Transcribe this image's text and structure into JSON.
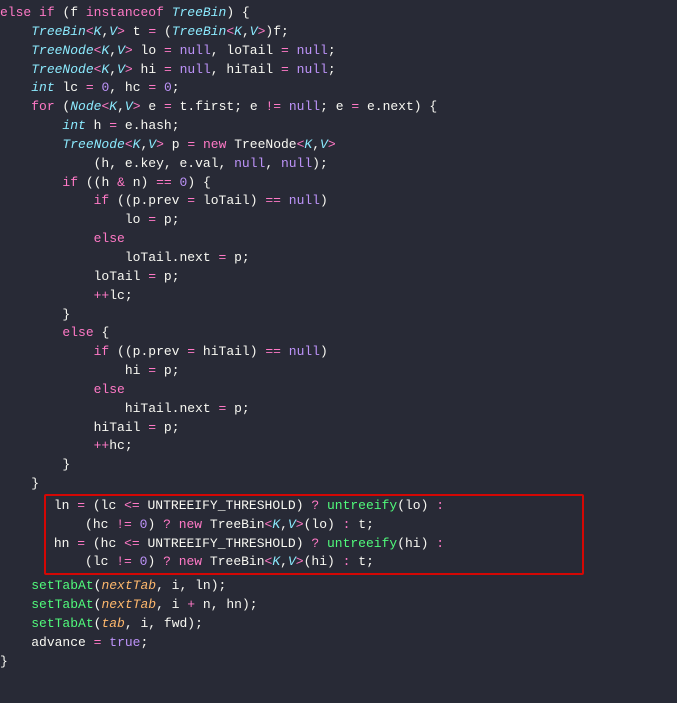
{
  "code": {
    "l01_else": "else",
    "l01_if": "if",
    "l01_f": "f",
    "l01_instanceof": "instanceof",
    "l01_TreeBin": "TreeBin",
    "l02_TreeBin": "TreeBin",
    "l02_K": "K",
    "l02_V": "V",
    "l02_t": "t",
    "l02_eq": "=",
    "l02_TreeBin2": "TreeBin",
    "l02_K2": "K",
    "l02_V2": "V",
    "l02_f": "f",
    "l03_TreeNode": "TreeNode",
    "l03_K": "K",
    "l03_V": "V",
    "l03_lo": "lo",
    "l03_eq1": "=",
    "l03_null1": "null",
    "l03_loTail": "loTail",
    "l03_eq2": "=",
    "l03_null2": "null",
    "l04_TreeNode": "TreeNode",
    "l04_K": "K",
    "l04_V": "V",
    "l04_hi": "hi",
    "l04_eq1": "=",
    "l04_null1": "null",
    "l04_hiTail": "hiTail",
    "l04_eq2": "=",
    "l04_null2": "null",
    "l05_int": "int",
    "l05_lc": "lc",
    "l05_eq1": "=",
    "l05_zero1": "0",
    "l05_hc": "hc",
    "l05_eq2": "=",
    "l05_zero2": "0",
    "l06_for": "for",
    "l06_Node": "Node",
    "l06_K": "K",
    "l06_V": "V",
    "l06_e": "e",
    "l06_eq1": "=",
    "l06_t": "t",
    "l06_first": "first",
    "l06_e2": "e",
    "l06_neq": "!=",
    "l06_null": "null",
    "l06_e3": "e",
    "l06_eq2": "=",
    "l06_e4": "e",
    "l06_next": "next",
    "l07_int": "int",
    "l07_h": "h",
    "l07_eq": "=",
    "l07_e": "e",
    "l07_hash": "hash",
    "l08_TreeNode": "TreeNode",
    "l08_K": "K",
    "l08_V": "V",
    "l08_p": "p",
    "l08_eq": "=",
    "l08_new": "new",
    "l08_TreeNode2": "TreeNode",
    "l08_K2": "K",
    "l08_V2": "V",
    "l09_h": "h",
    "l09_e1": "e",
    "l09_key": "key",
    "l09_e2": "e",
    "l09_val": "val",
    "l09_null1": "null",
    "l09_null2": "null",
    "l10_if": "if",
    "l10_h": "h",
    "l10_amp": "&",
    "l10_n": "n",
    "l10_eqeq": "==",
    "l10_zero": "0",
    "l11_if": "if",
    "l11_p": "p",
    "l11_prev": "prev",
    "l11_eq": "=",
    "l11_loTail": "loTail",
    "l11_eqeq": "==",
    "l11_null": "null",
    "l12_lo": "lo",
    "l12_eq": "=",
    "l12_p": "p",
    "l13_else": "else",
    "l14_loTail": "loTail",
    "l14_next": "next",
    "l14_eq": "=",
    "l14_p": "p",
    "l15_loTail": "loTail",
    "l15_eq": "=",
    "l15_p": "p",
    "l16_pp": "++",
    "l16_lc": "lc",
    "l18_else": "else",
    "l19_if": "if",
    "l19_p": "p",
    "l19_prev": "prev",
    "l19_eq": "=",
    "l19_hiTail": "hiTail",
    "l19_eqeq": "==",
    "l19_null": "null",
    "l20_hi": "hi",
    "l20_eq": "=",
    "l20_p": "p",
    "l21_else": "else",
    "l22_hiTail": "hiTail",
    "l22_next": "next",
    "l22_eq": "=",
    "l22_p": "p",
    "l23_hiTail": "hiTail",
    "l23_eq": "=",
    "l23_p": "p",
    "l24_pp": "++",
    "l24_hc": "hc",
    "l27_ln": "ln",
    "l27_eq": "=",
    "l27_lc": "lc",
    "l27_lte": "<=",
    "l27_const": "UNTREEIFY_THRESHOLD",
    "l27_q": "?",
    "l27_untreeify": "untreeify",
    "l27_lo": "lo",
    "l27_colon": ":",
    "l28_hc": "hc",
    "l28_neq": "!=",
    "l28_zero": "0",
    "l28_q": "?",
    "l28_new": "new",
    "l28_TreeBin": "TreeBin",
    "l28_K": "K",
    "l28_V": "V",
    "l28_lo": "lo",
    "l28_colon": ":",
    "l28_t": "t",
    "l29_hn": "hn",
    "l29_eq": "=",
    "l29_hc": "hc",
    "l29_lte": "<=",
    "l29_const": "UNTREEIFY_THRESHOLD",
    "l29_q": "?",
    "l29_untreeify": "untreeify",
    "l29_hi": "hi",
    "l29_colon": ":",
    "l30_lc": "lc",
    "l30_neq": "!=",
    "l30_zero": "0",
    "l30_q": "?",
    "l30_new": "new",
    "l30_TreeBin": "TreeBin",
    "l30_K": "K",
    "l30_V": "V",
    "l30_hi": "hi",
    "l30_colon": ":",
    "l30_t": "t",
    "l31_setTabAt": "setTabAt",
    "l31_nextTab": "nextTab",
    "l31_i": "i",
    "l31_ln": "ln",
    "l32_setTabAt": "setTabAt",
    "l32_nextTab": "nextTab",
    "l32_i": "i",
    "l32_plus": "+",
    "l32_n": "n",
    "l32_hn": "hn",
    "l33_setTabAt": "setTabAt",
    "l33_tab": "tab",
    "l33_i": "i",
    "l33_fwd": "fwd",
    "l34_advance": "advance",
    "l34_eq": "=",
    "l34_true": "true"
  }
}
